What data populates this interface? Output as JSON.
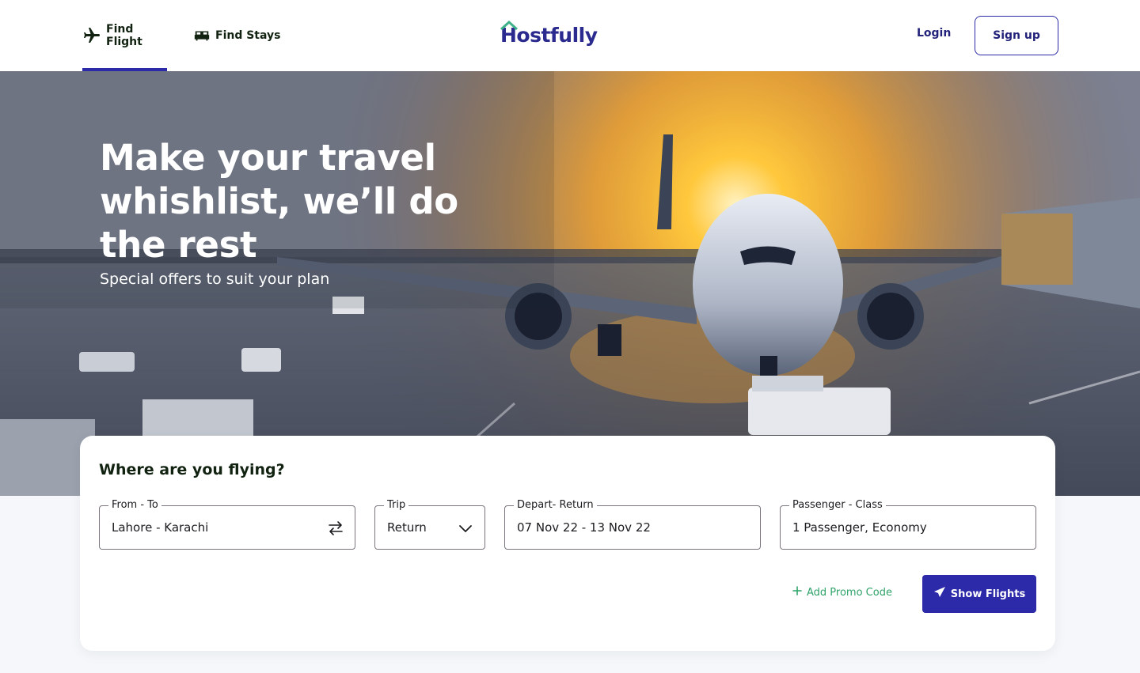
{
  "nav": {
    "tabs": [
      {
        "label": "Find Flight",
        "icon": "airplane-icon",
        "active": true
      },
      {
        "label": "Find Stays",
        "icon": "bed-icon",
        "active": false
      }
    ],
    "logo": "Hostfully",
    "login_label": "Login",
    "signup_label": "Sign up"
  },
  "hero": {
    "title": "Make your travel whishlist, we’ll do the rest",
    "subtitle": "Special offers to suit your plan"
  },
  "search": {
    "title": "Where are you flying?",
    "fields": [
      {
        "label": "From - To",
        "value": "Lahore - Karachi",
        "icon": "swap-icon"
      },
      {
        "label": "Trip",
        "value": "Return",
        "icon": "chevron-down-icon"
      },
      {
        "label": "Depart- Return",
        "value": "07 Nov 22 - 13 Nov 22"
      },
      {
        "label": "Passenger - Class",
        "value": "1 Passenger, Economy"
      }
    ],
    "promo_label": "Add Promo Code",
    "submit_label": "Show Flights"
  },
  "colors": {
    "brand": "#2c2aa8",
    "promo_green": "#2fa36a",
    "text_dark": "#112211"
  }
}
